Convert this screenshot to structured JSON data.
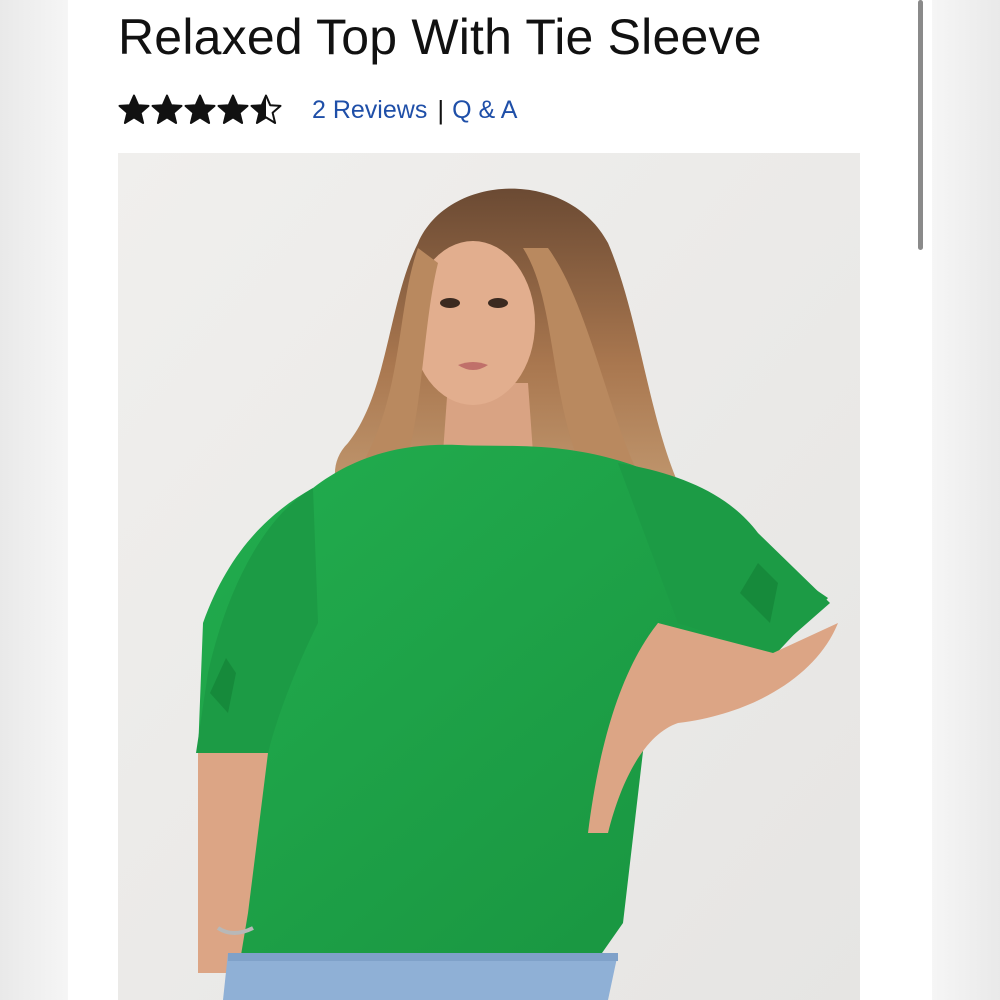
{
  "product": {
    "title": "Relaxed Top With Tie Sleeve",
    "rating": 4.5,
    "rating_max": 5,
    "reviews_link": "2 Reviews",
    "separator": "|",
    "qa_link": "Q & A",
    "image_icon": "product-photo",
    "shirt_color": "#1fa44a"
  },
  "colors": {
    "link": "#1f4fa8",
    "star": "#111111",
    "background": "#ffffff"
  }
}
